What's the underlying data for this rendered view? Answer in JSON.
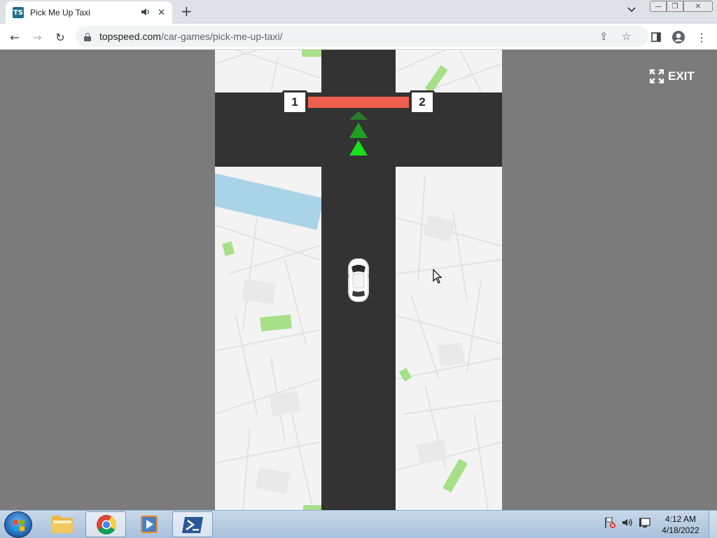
{
  "browser": {
    "tab": {
      "title": "Pick Me Up Taxi",
      "favicon_text": "TS",
      "audio_icon": "speaker-icon",
      "close_glyph": "✕"
    },
    "new_tab_glyph": "+",
    "tab_menu_glyph": "⌄",
    "window_controls": {
      "minimize": "—",
      "maximize": "❐",
      "close": "✕"
    },
    "toolbar": {
      "back_glyph": "←",
      "forward_glyph": "→",
      "reload_glyph": "↻",
      "url_domain": "topspeed.com",
      "url_path": "/car-games/pick-me-up-taxi/",
      "share_glyph": "⇪",
      "star_glyph": "☆",
      "sidepanel_glyph": "▣",
      "profile_glyph": "●",
      "menu_glyph": "⋮"
    }
  },
  "game": {
    "progress": {
      "start_label": "1",
      "end_label": "2",
      "fraction": 1.0
    },
    "exit_label": "EXIT",
    "colors": {
      "road": "#333333",
      "ground": "#f3f3f3",
      "progress_fill": "#ef5f4f",
      "arrow_dim": "#2a7a2a",
      "arrow_mid": "#1f9e1f",
      "arrow_bright": "#19e019",
      "park": "#a8e08a",
      "water": "#a9d4e8"
    }
  },
  "taskbar": {
    "items": [
      "windows-explorer-icon",
      "chrome-icon",
      "media-player-icon",
      "powershell-icon"
    ],
    "tray_icons": [
      "network-flag-icon",
      "volume-icon",
      "display-icon"
    ],
    "time": "4:12 AM",
    "date": "4/18/2022"
  }
}
